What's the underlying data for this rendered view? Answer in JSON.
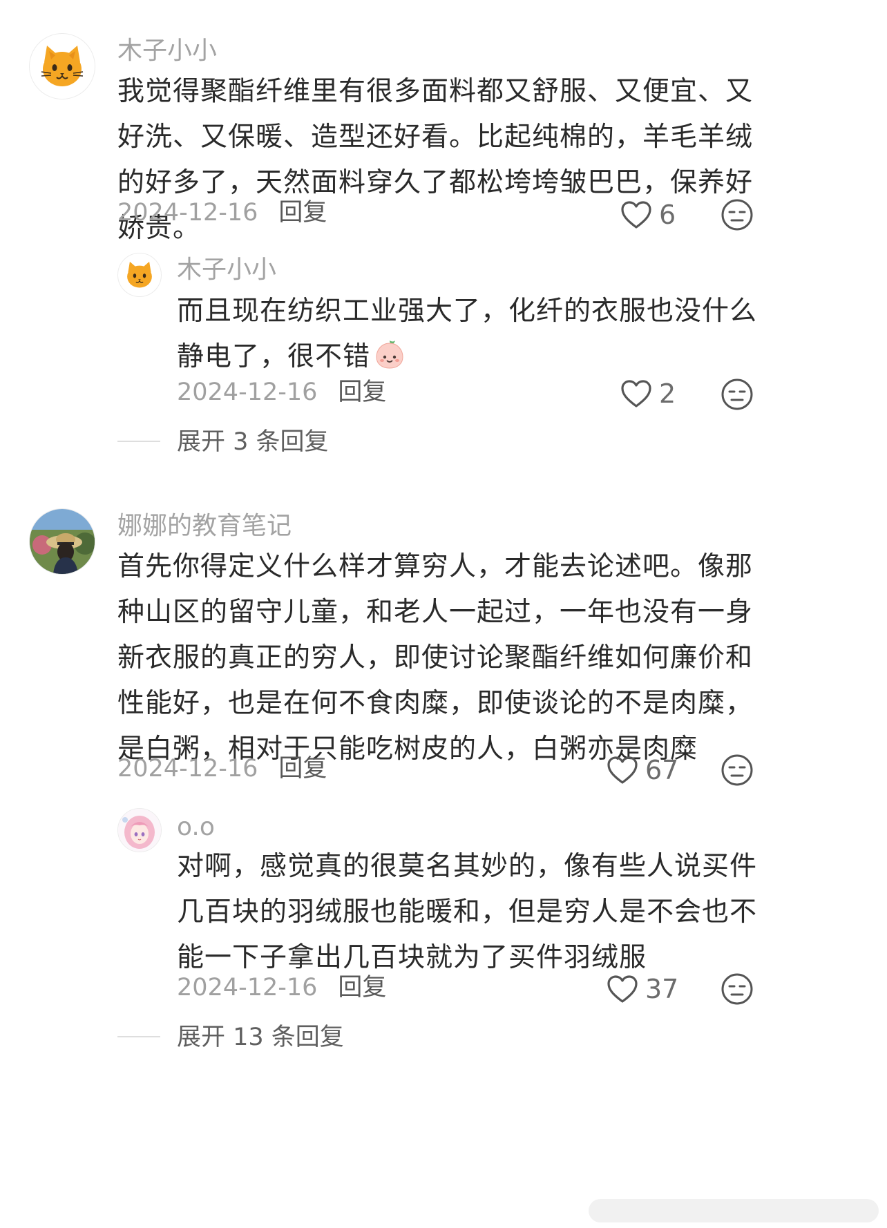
{
  "comments": [
    {
      "user": "木子小小",
      "avatar_icon": "orange-cat-emoji",
      "text": "我觉得聚酯纤维里有很多面料都又舒服、又便宜、又好洗、又保暖、造型还好看。比起纯棉的，羊毛羊绒的好多了，天然面料穿久了都松垮垮皱巴巴，保养好娇贵。",
      "date": "2024-12-16",
      "reply_label": "回复",
      "likes": "6",
      "replies": [
        {
          "user": "木子小小",
          "avatar_icon": "orange-cat-emoji",
          "text": "而且现在纺织工业强大了，化纤的衣服也没什么静电了，很不错",
          "inline_emoji": "peach-smile-emoji",
          "date": "2024-12-16",
          "reply_label": "回复",
          "likes": "2"
        }
      ],
      "expand_label": "展开 3 条回复"
    },
    {
      "user": "娜娜的教育笔记",
      "avatar_icon": "photo-girl-straw-hat",
      "text": "首先你得定义什么样才算穷人，才能去论述吧。像那种山区的留守儿童，和老人一起过，一年也没有一身新衣服的真正的穷人，即使讨论聚酯纤维如何廉价和性能好，也是在何不食肉糜，即使谈论的不是肉糜，是白粥，相对于只能吃树皮的人，白粥亦是肉糜",
      "date": "2024-12-16",
      "reply_label": "回复",
      "likes": "67",
      "replies": [
        {
          "user": "o.o",
          "avatar_icon": "anime-pink-hair-girl",
          "text": "对啊，感觉真的很莫名其妙的，像有些人说买件几百块的羽绒服也能暖和，但是穷人是不会也不能一下子拿出几百块就为了买件羽绒服",
          "date": "2024-12-16",
          "reply_label": "回复",
          "likes": "37"
        }
      ],
      "expand_label": "展开 13 条回复"
    }
  ],
  "icons": {
    "like": "heart-outline-icon",
    "face": "neutral-face-icon"
  },
  "colors": {
    "username": "#a3a3a3",
    "body": "#2a2a2a",
    "meta": "#a0a0a0",
    "reply": "#595959",
    "cat_orange": "#f5a623"
  }
}
